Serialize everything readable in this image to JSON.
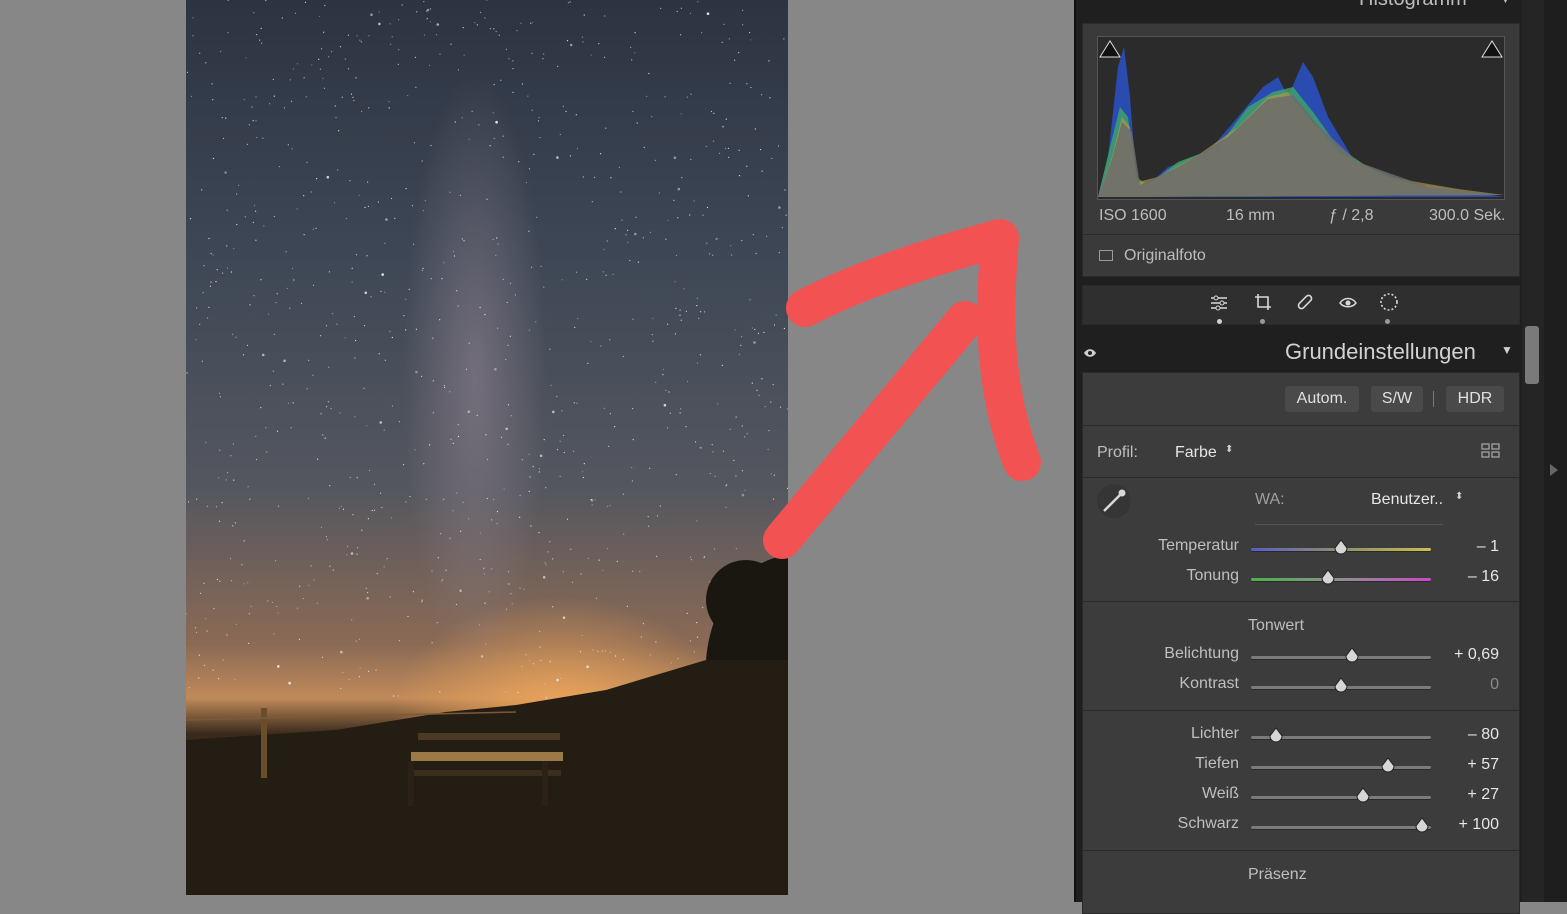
{
  "histogram": {
    "title": "Histogramm",
    "iso": "ISO 1600",
    "focal": "16 mm",
    "aperture": "ƒ / 2,8",
    "shutter": "300.0 Sek.",
    "original_photo_label": "Originalfoto"
  },
  "tools": [
    "edit-sliders-icon",
    "crop-icon",
    "healing-icon",
    "red-eye-icon",
    "mask-icon"
  ],
  "basic": {
    "title": "Grundeinstellungen",
    "auto_label": "Autom.",
    "bw_label": "S/W",
    "hdr_label": "HDR",
    "profile_label": "Profil:",
    "profile_value": "Farbe",
    "wb_label": "WA:",
    "wb_value": "Benutzer..",
    "tone_heading": "Tonwert",
    "presence_heading": "Präsenz",
    "sliders": [
      {
        "label": "Temperatur",
        "value": "– 1",
        "pos": 0.5,
        "kind": "temp"
      },
      {
        "label": "Tonung",
        "value": "– 16",
        "pos": 0.43,
        "kind": "tint"
      },
      {
        "label": "Belichtung",
        "value": "+ 0,69",
        "pos": 0.56,
        "kind": "plain"
      },
      {
        "label": "Kontrast",
        "value": "0",
        "pos": 0.5,
        "kind": "plain"
      },
      {
        "label": "Lichter",
        "value": "– 80",
        "pos": 0.14,
        "kind": "plain"
      },
      {
        "label": "Tiefen",
        "value": "+ 57",
        "pos": 0.76,
        "kind": "plain"
      },
      {
        "label": "Weiß",
        "value": "+ 27",
        "pos": 0.62,
        "kind": "plain"
      },
      {
        "label": "Schwarz",
        "value": "+ 100",
        "pos": 0.95,
        "kind": "plain"
      }
    ]
  },
  "colors": {
    "annotation_arrow": "#f35252",
    "panel_bg": "#3c3c3c"
  }
}
